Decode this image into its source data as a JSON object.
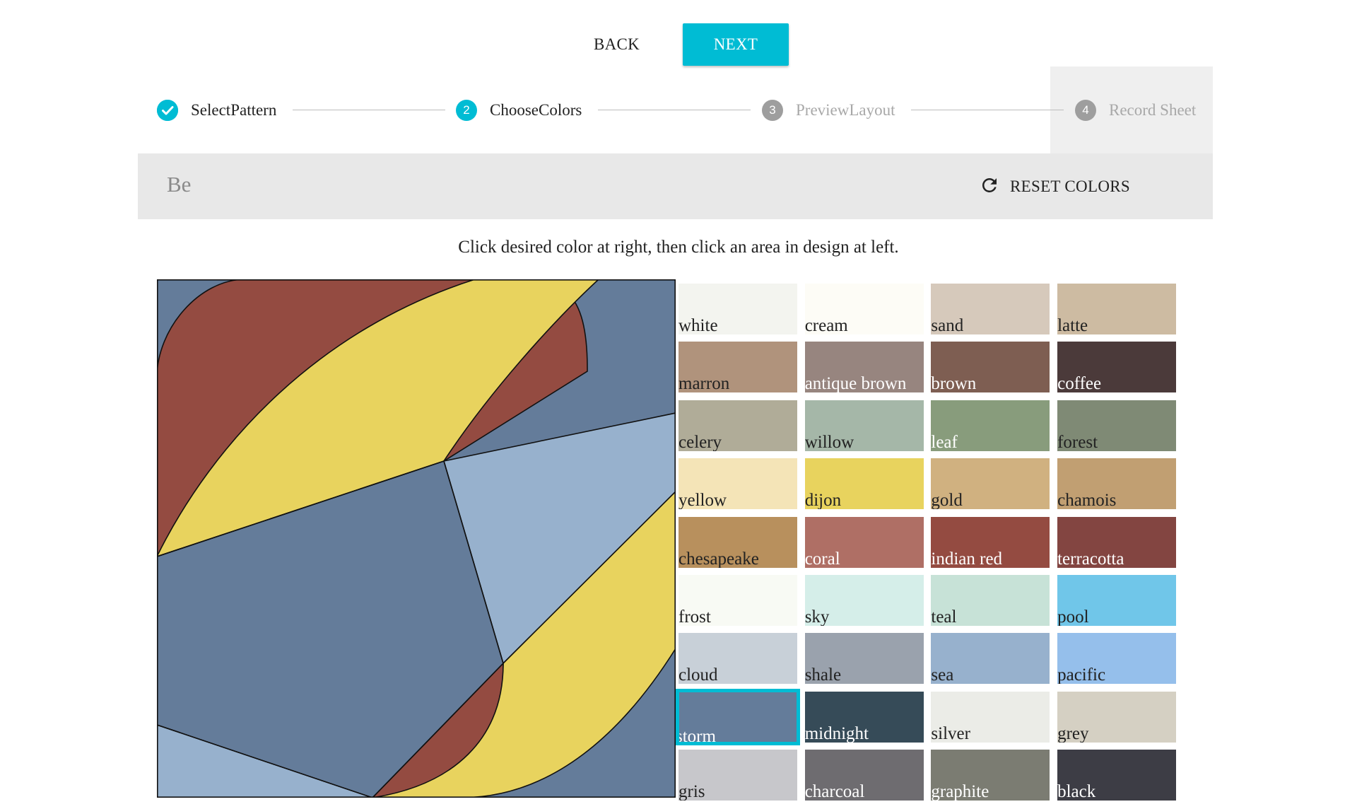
{
  "nav": {
    "back_label": "BACK",
    "next_label": "NEXT"
  },
  "stepper": {
    "steps": [
      {
        "number": "1",
        "label": "SelectPattern",
        "state": "completed"
      },
      {
        "number": "2",
        "label": "ChooseColors",
        "state": "active"
      },
      {
        "number": "3",
        "label": "PreviewLayout",
        "state": "pending"
      },
      {
        "number": "4",
        "label": "Record Sheet",
        "state": "pending"
      }
    ]
  },
  "design_name": "Be",
  "reset_label": "RESET COLORS",
  "instructions": "Click desired color at right, then click an area in design at left.",
  "selected_color": "storm",
  "design_colors": {
    "yellow": "#e8d35e",
    "red": "#944b41",
    "storm": "#647c9a",
    "sea": "#97b1cd"
  },
  "palette": [
    {
      "name": "white",
      "hex": "#f3f4ef",
      "text": "#222222"
    },
    {
      "name": "cream",
      "hex": "#fdfcf6",
      "text": "#222222"
    },
    {
      "name": "sand",
      "hex": "#d6c9bb",
      "text": "#222222"
    },
    {
      "name": "latte",
      "hex": "#cdbba2",
      "text": "#222222"
    },
    {
      "name": "marron",
      "hex": "#b0937c",
      "text": "#222222"
    },
    {
      "name": "antique brown",
      "hex": "#97857f",
      "text": "#ffffff"
    },
    {
      "name": "brown",
      "hex": "#7e5e52",
      "text": "#ffffff"
    },
    {
      "name": "coffee",
      "hex": "#4b3a3a",
      "text": "#ffffff"
    },
    {
      "name": "celery",
      "hex": "#b0ac98",
      "text": "#222222"
    },
    {
      "name": "willow",
      "hex": "#a5b7a8",
      "text": "#222222"
    },
    {
      "name": "leaf",
      "hex": "#889c7c",
      "text": "#ffffff"
    },
    {
      "name": "forest",
      "hex": "#7f8a75",
      "text": "#222222"
    },
    {
      "name": "yellow",
      "hex": "#f4e4b7",
      "text": "#222222"
    },
    {
      "name": "dijon",
      "hex": "#e8d35e",
      "text": "#222222"
    },
    {
      "name": "gold",
      "hex": "#d0b180",
      "text": "#222222"
    },
    {
      "name": "chamois",
      "hex": "#c19f72",
      "text": "#222222"
    },
    {
      "name": "chesapeake",
      "hex": "#b8905d",
      "text": "#222222"
    },
    {
      "name": "coral",
      "hex": "#af6f65",
      "text": "#ffffff"
    },
    {
      "name": "indian red",
      "hex": "#944b41",
      "text": "#ffffff"
    },
    {
      "name": "terracotta",
      "hex": "#834541",
      "text": "#ffffff"
    },
    {
      "name": "frost",
      "hex": "#f8faf4",
      "text": "#222222"
    },
    {
      "name": "sky",
      "hex": "#d5eee9",
      "text": "#222222"
    },
    {
      "name": "teal",
      "hex": "#c7e2d7",
      "text": "#222222"
    },
    {
      "name": "pool",
      "hex": "#70c6e9",
      "text": "#222222"
    },
    {
      "name": "cloud",
      "hex": "#c8d0d8",
      "text": "#222222"
    },
    {
      "name": "shale",
      "hex": "#9aa2ad",
      "text": "#222222"
    },
    {
      "name": "sea",
      "hex": "#97b1cd",
      "text": "#222222"
    },
    {
      "name": "pacific",
      "hex": "#95bfeb",
      "text": "#222222"
    },
    {
      "name": "storm",
      "hex": "#647c9a",
      "text": "#ffffff"
    },
    {
      "name": "midnight",
      "hex": "#364b58",
      "text": "#ffffff"
    },
    {
      "name": "silver",
      "hex": "#ebece7",
      "text": "#222222"
    },
    {
      "name": "grey",
      "hex": "#d5d0c3",
      "text": "#222222"
    },
    {
      "name": "gris",
      "hex": "#c7c7cb",
      "text": "#222222"
    },
    {
      "name": "charcoal",
      "hex": "#6e6c70",
      "text": "#ffffff"
    },
    {
      "name": "graphite",
      "hex": "#7b7c72",
      "text": "#ffffff"
    },
    {
      "name": "black",
      "hex": "#3d3d45",
      "text": "#ffffff"
    }
  ]
}
